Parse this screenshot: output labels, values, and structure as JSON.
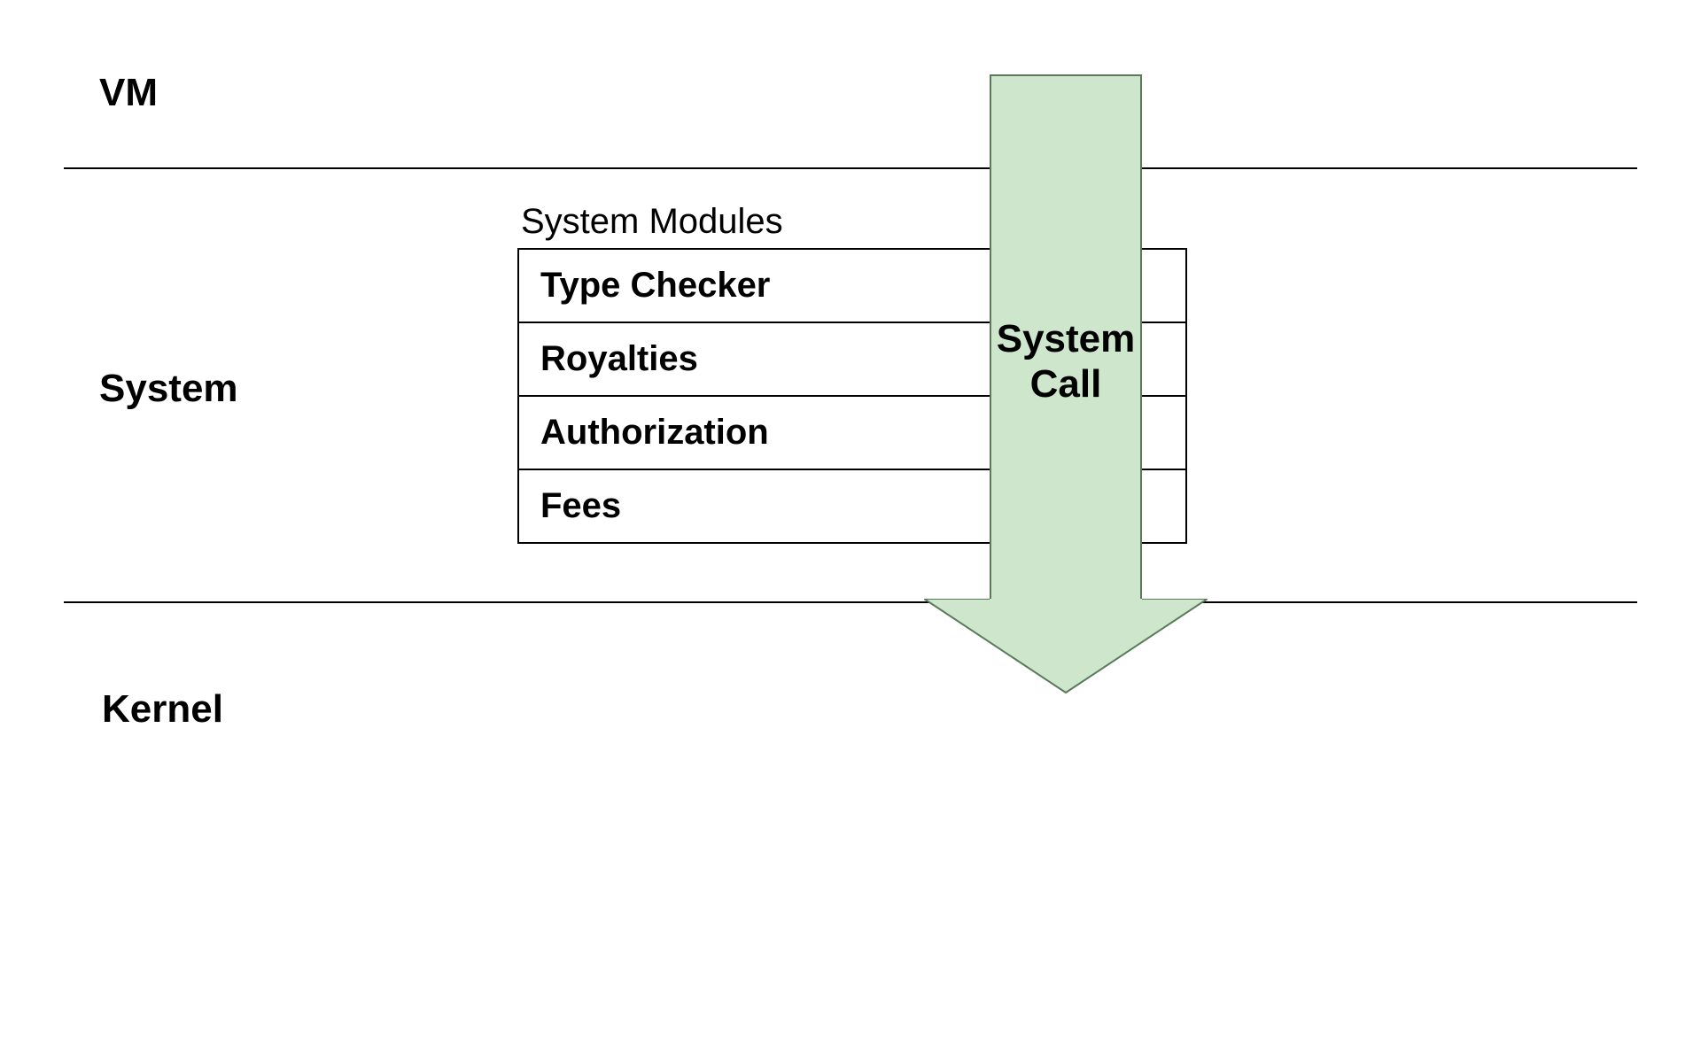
{
  "layers": {
    "vm": "VM",
    "system": "System",
    "kernel": "Kernel"
  },
  "modules": {
    "caption": "System Modules",
    "items": [
      "Type Checker",
      "Royalties",
      "Authorization",
      "Fees"
    ]
  },
  "arrow": {
    "line1": "System",
    "line2": "Call"
  },
  "colors": {
    "arrow_fill": "#cde6cc",
    "arrow_stroke": "#5a7b59"
  }
}
